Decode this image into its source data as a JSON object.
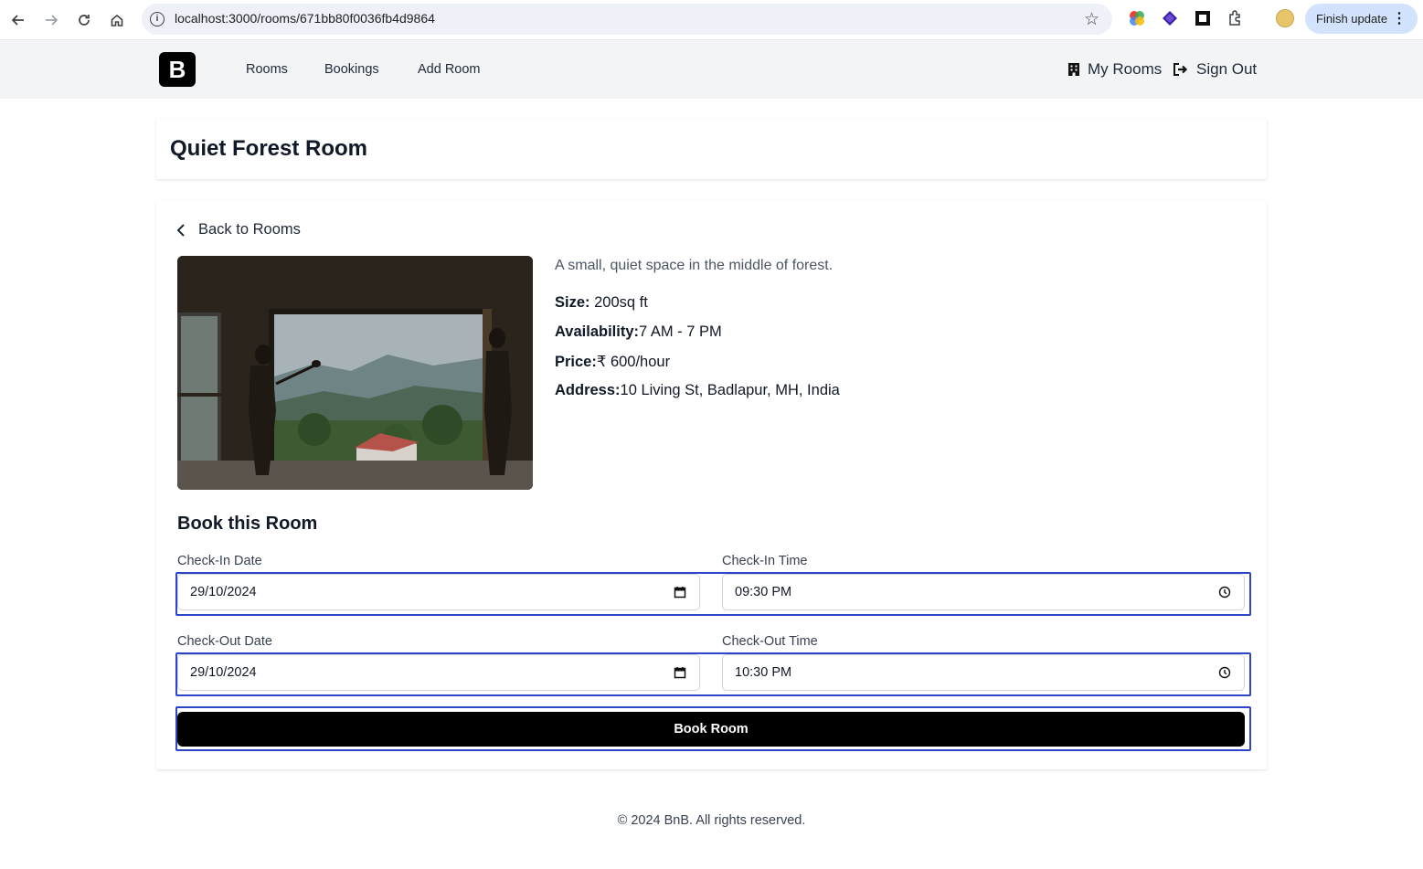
{
  "browser": {
    "url": "localhost:3000/rooms/671bb80f0036fb4d9864",
    "finish_update_label": "Finish update"
  },
  "navbar": {
    "logo_letter": "B",
    "links": [
      "Rooms",
      "Bookings",
      "Add Room"
    ],
    "my_rooms_label": "My Rooms",
    "sign_out_label": "Sign Out"
  },
  "room": {
    "title": "Quiet Forest Room",
    "back_label": "Back to Rooms",
    "description": "A small, quiet space in the middle of forest.",
    "size_label": "Size:",
    "size_value": " 200sq ft",
    "availability_label": "Availability:",
    "availability_value": "7 AM - 7 PM",
    "price_label": "Price:",
    "price_value": "₹ 600/hour",
    "address_label": "Address:",
    "address_value": "10 Living St, Badlapur, MH, India"
  },
  "booking": {
    "section_title": "Book this Room",
    "check_in_date_label": "Check-In Date",
    "check_in_date_value": "29/10/2024",
    "check_in_time_label": "Check-In Time",
    "check_in_time_value": "09:30  PM",
    "check_out_date_label": "Check-Out Date",
    "check_out_date_value": "29/10/2024",
    "check_out_time_label": "Check-Out Time",
    "check_out_time_value": "10:30  PM",
    "submit_label": "Book Room"
  },
  "footer": {
    "text": "© 2024 BnB. All rights reserved."
  },
  "colors": {
    "focus_ring": "#2f45c9",
    "primary_button": "#000000",
    "navbar_bg": "#f3f4f6",
    "update_chip": "#d3e3fd"
  }
}
